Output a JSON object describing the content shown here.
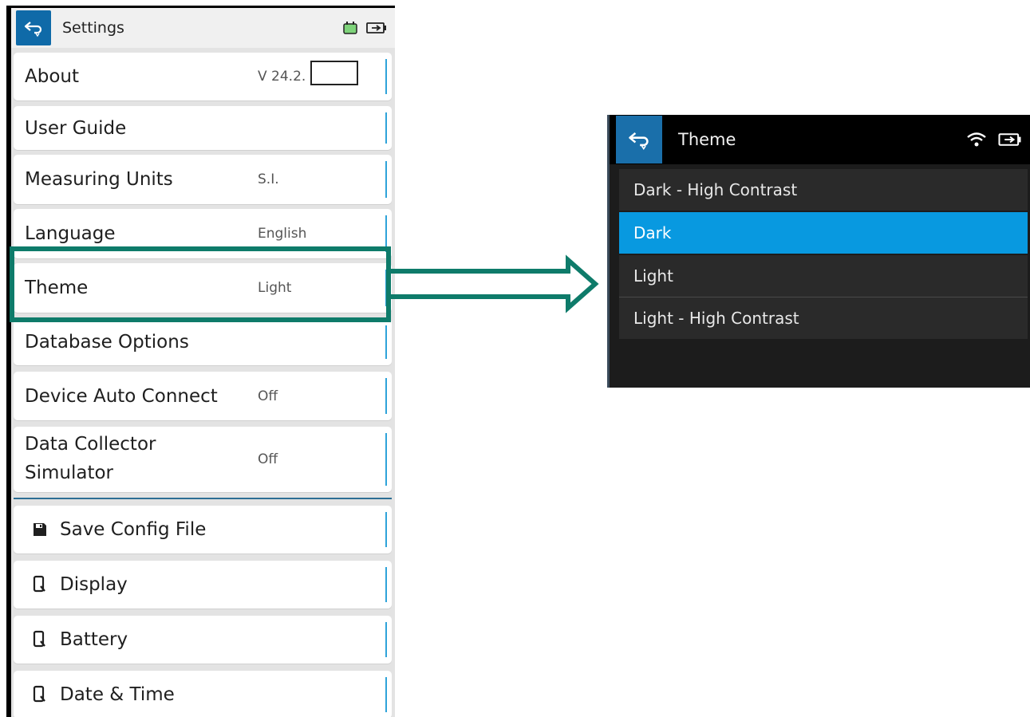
{
  "settings": {
    "title": "Settings",
    "rows": [
      {
        "label": "About",
        "value": "V 24.2."
      },
      {
        "label": "User Guide",
        "value": ""
      },
      {
        "label": "Measuring Units",
        "value": "S.I."
      },
      {
        "label": "Language",
        "value": "English"
      },
      {
        "label": "Theme",
        "value": "Light"
      },
      {
        "label": "Database Options",
        "value": ""
      },
      {
        "label": "Device Auto Connect",
        "value": "Off"
      },
      {
        "label": "Data Collector Simulator",
        "label_line1": "Data Collector",
        "label_line2": "Simulator",
        "value": "Off"
      }
    ],
    "device_rows": [
      {
        "label": "Save Config File",
        "icon": "floppy-disk-icon"
      },
      {
        "label": "Display",
        "icon": "device-phone-icon"
      },
      {
        "label": "Battery",
        "icon": "device-phone-icon"
      },
      {
        "label": "Date & Time",
        "icon": "device-phone-icon"
      }
    ],
    "status_icons": [
      "device-battery-icon",
      "battery-icon"
    ],
    "colors": {
      "accent": "#0f6aa8",
      "divider": "#2ea3d9",
      "highlight": "#0e7b6a"
    }
  },
  "theme": {
    "title": "Theme",
    "options": [
      "Dark - High Contrast",
      "Dark",
      "Light",
      "Light - High Contrast"
    ],
    "selected": "Dark",
    "status_icons": [
      "wifi-icon",
      "battery-icon"
    ],
    "colors": {
      "selected": "#0899e0",
      "background": "#1c1c1c"
    }
  }
}
